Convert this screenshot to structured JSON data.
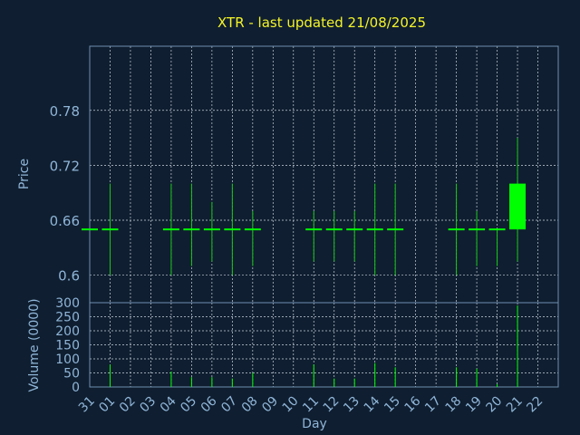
{
  "chart_data": {
    "type": "candlestick",
    "title": "XTR - last updated 21/08/2025",
    "xlabel": "Day",
    "x_tick_labels": [
      "31",
      "01",
      "02",
      "03",
      "04",
      "05",
      "06",
      "07",
      "08",
      "09",
      "10",
      "11",
      "12",
      "13",
      "14",
      "15",
      "16",
      "17",
      "18",
      "19",
      "20",
      "21",
      "22"
    ],
    "price_panel": {
      "ylabel": "Price",
      "ylim": [
        0.57,
        0.85
      ],
      "y_ticks": [
        0.6,
        0.66,
        0.72,
        0.78
      ],
      "y_tick_labels": [
        "0.6",
        "0.66",
        "0.72",
        "0.78"
      ],
      "candles": [
        {
          "day": "31",
          "open": 0.65,
          "high": 0.65,
          "low": 0.65,
          "close": 0.65
        },
        {
          "day": "01",
          "open": 0.65,
          "high": 0.7,
          "low": 0.6,
          "close": 0.65
        },
        {
          "day": "04",
          "open": 0.65,
          "high": 0.7,
          "low": 0.6,
          "close": 0.65
        },
        {
          "day": "05",
          "open": 0.65,
          "high": 0.7,
          "low": 0.61,
          "close": 0.65
        },
        {
          "day": "06",
          "open": 0.65,
          "high": 0.68,
          "low": 0.615,
          "close": 0.65
        },
        {
          "day": "07",
          "open": 0.65,
          "high": 0.7,
          "low": 0.6,
          "close": 0.65
        },
        {
          "day": "08",
          "open": 0.65,
          "high": 0.67,
          "low": 0.61,
          "close": 0.65
        },
        {
          "day": "11",
          "open": 0.65,
          "high": 0.67,
          "low": 0.615,
          "close": 0.65
        },
        {
          "day": "12",
          "open": 0.65,
          "high": 0.67,
          "low": 0.615,
          "close": 0.65
        },
        {
          "day": "13",
          "open": 0.65,
          "high": 0.67,
          "low": 0.615,
          "close": 0.65
        },
        {
          "day": "14",
          "open": 0.65,
          "high": 0.7,
          "low": 0.6,
          "close": 0.65
        },
        {
          "day": "15",
          "open": 0.65,
          "high": 0.7,
          "low": 0.6,
          "close": 0.65
        },
        {
          "day": "18",
          "open": 0.65,
          "high": 0.7,
          "low": 0.6,
          "close": 0.65
        },
        {
          "day": "19",
          "open": 0.65,
          "high": 0.67,
          "low": 0.61,
          "close": 0.65
        },
        {
          "day": "20",
          "open": 0.65,
          "high": 0.65,
          "low": 0.61,
          "close": 0.65
        },
        {
          "day": "21",
          "open": 0.65,
          "high": 0.75,
          "low": 0.615,
          "close": 0.7
        }
      ]
    },
    "volume_panel": {
      "ylabel": "Volume (0000)",
      "ylim": [
        0,
        300
      ],
      "y_ticks": [
        0,
        50,
        100,
        150,
        200,
        250,
        300
      ],
      "y_tick_labels": [
        "0",
        "50",
        "100",
        "150",
        "200",
        "250",
        "300"
      ],
      "bars": [
        {
          "day": "01",
          "volume": 80
        },
        {
          "day": "04",
          "volume": 55
        },
        {
          "day": "05",
          "volume": 35
        },
        {
          "day": "06",
          "volume": 35
        },
        {
          "day": "07",
          "volume": 30
        },
        {
          "day": "08",
          "volume": 50
        },
        {
          "day": "11",
          "volume": 80
        },
        {
          "day": "12",
          "volume": 30
        },
        {
          "day": "13",
          "volume": 30
        },
        {
          "day": "14",
          "volume": 85
        },
        {
          "day": "15",
          "volume": 70
        },
        {
          "day": "18",
          "volume": 70
        },
        {
          "day": "19",
          "volume": 65
        },
        {
          "day": "20",
          "volume": 10
        },
        {
          "day": "21",
          "volume": 290
        }
      ]
    },
    "grid": true,
    "colors": {
      "background": "#0f1e30",
      "text": "#8fb5d8",
      "title": "#f4f428",
      "axis": "#6f8fb0",
      "grid": "#c8d2de",
      "candle": "#00ff00",
      "wick": "#18c818"
    }
  }
}
